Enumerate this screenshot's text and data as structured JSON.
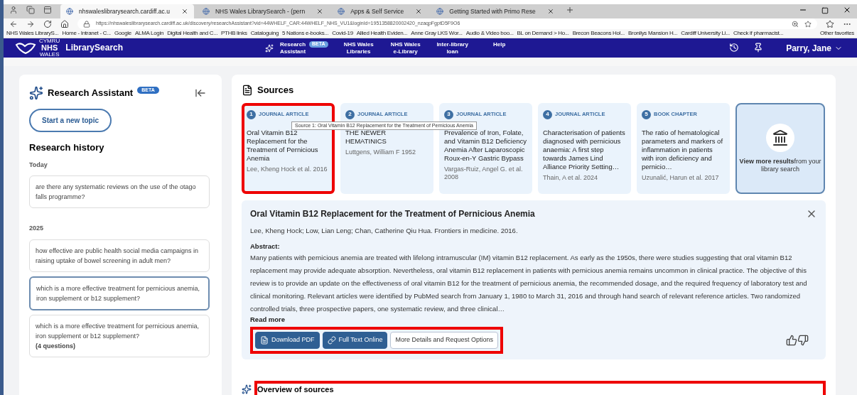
{
  "browser": {
    "tabs": [
      {
        "title": "nhswaleslibrarysearch.cardiff.ac.u",
        "selected": true
      },
      {
        "title": "NHS Wales LibrarySearch - (pern",
        "selected": false
      },
      {
        "title": "Apps & Self Service",
        "selected": false
      },
      {
        "title": "Getting Started with Primo Rese",
        "selected": false
      }
    ],
    "url": "https://nhswaleslibrarysearch.cardiff.ac.uk/discovery/researchAssistant?vid=44WHELF_CAR:44WHELF_NHS_VU1&loginId=1951358820002420_nzaqpFgptD5F9O6",
    "bookmarks": [
      "NHS Wales LibraryS...",
      "Home - Intranet - C...",
      "Google",
      "ALMA Login",
      "Digital Health and C...",
      "PTHB links",
      "Cataloguing",
      "5 Nations e-books...",
      "Covid-19",
      "Allied Health Eviden...",
      "Anne Gray LKS Wor...",
      "Audio & Video boo...",
      "BL on Demand > Ho...",
      "Brecon Beacons Hol...",
      "Bronllys Mansion H...",
      "Cardiff University Li...",
      "Check if pharmacist..."
    ],
    "other_favorites": "Other favorites"
  },
  "header": {
    "logo_small": "CYMRU",
    "logo_big": "NHS",
    "logo_sub": "WALES",
    "brand": "LibrarySearch",
    "nav": [
      {
        "label": "Research Assistant",
        "badge": "BETA"
      },
      {
        "label": "NHS Wales Libraries"
      },
      {
        "label": "NHS Wales e-Library"
      },
      {
        "label": "Inter-library loan"
      },
      {
        "label": "Help"
      }
    ],
    "user": "Parry, Jane"
  },
  "sidebar": {
    "title": "Research Assistant",
    "badge": "BETA",
    "new_topic": "Start a new topic",
    "history_title": "Research history",
    "groups": [
      {
        "label": "Today",
        "items": [
          {
            "text": "are there any systematic reviews on the use of the otago falls programme?",
            "selected": false
          }
        ]
      },
      {
        "label": "2025",
        "items": [
          {
            "text": "how effective are public health social media campaigns in raising uptake of bowel screening in adult men?",
            "selected": false
          },
          {
            "text": "which is a more effective treatment for pernicious anemia, iron supplement or b12 supplement?",
            "selected": true
          },
          {
            "text": "which is a more effective treatment for pernicious anemia, iron supplement or b12 supplement?",
            "count": "(4 questions)",
            "selected": false
          }
        ]
      }
    ]
  },
  "sources": {
    "title": "Sources",
    "cards": [
      {
        "number": "1",
        "type": "JOURNAL ARTICLE",
        "title": "Oral Vitamin B12 Replacement for the Treatment of Pernicious Anemia",
        "authors": "Lee, Kheng Hock et al. 2016",
        "highlighted": true
      },
      {
        "number": "2",
        "type": "JOURNAL ARTICLE",
        "title": "THE NEWER HEMATINICS",
        "authors": "Luttgens, William F 1952",
        "highlighted": false
      },
      {
        "number": "3",
        "type": "JOURNAL ARTICLE",
        "title": "Prevalence of Iron, Folate, and Vitamin B12 Deficiency Anemia After Laparoscopic Roux-en-Y Gastric Bypass",
        "authors": "Vargas-Ruiz, Angel G. et al. 2008",
        "highlighted": false
      },
      {
        "number": "4",
        "type": "JOURNAL ARTICLE",
        "title": "Characterisation of patients diagnosed with pernicious anaemia: A first step towards James Lind Alliance Priority Setting…",
        "authors": "Thain, A et al. 2024",
        "highlighted": false
      },
      {
        "number": "5",
        "type": "BOOK CHAPTER",
        "title": "The ratio of hematological parameters and markers of inflammation in patients with iron deficiency and pernicio…",
        "authors": "Uzunalić, Harun et al. 2017",
        "highlighted": false
      }
    ],
    "more": "**View more results**from your library search",
    "tooltip": "Source 1: Oral Vitamin B12 Replacement for the Treatment of Pernicious Anemia"
  },
  "detail": {
    "title": "Oral Vitamin B12 Replacement for the Treatment of Pernicious Anemia",
    "citation": "Lee, Kheng Hock; Low, Lian Leng; Chan, Catherine Qiu Hua. Frontiers in medicine. 2016.",
    "abstract_label": "Abstract:",
    "abstract": "Many patients with pernicious anemia are treated with lifelong intramuscular (IM) vitamin B12 replacement. As early as the 1950s, there were studies suggesting that oral vitamin B12 replacement may provide adequate absorption. Nevertheless, oral vitamin B12 replacement in patients with pernicious anemia remains uncommon in clinical practice. The objective of this review is to provide an update on the effectiveness of oral vitamin B12 for the treatment of pernicious anemia, the recommended dosage, and the required frequency of laboratory test and clinical monitoring. Relevant articles were identified by PubMed search from January 1, 1980 to March 31, 2016 and through hand search of relevant reference articles. Two randomized controlled trials, three prospective papers, one systematic review, and three clinical…",
    "read_more": "Read more",
    "buttons": [
      {
        "label": "Download PDF",
        "kind": "pdf"
      },
      {
        "label": "Full Text Online",
        "kind": "link"
      },
      {
        "label": "More Details and Request Options",
        "kind": "plain"
      }
    ],
    "buttons_highlighted": true
  },
  "overview": {
    "title": "Overview of sources",
    "highlighted": true
  }
}
